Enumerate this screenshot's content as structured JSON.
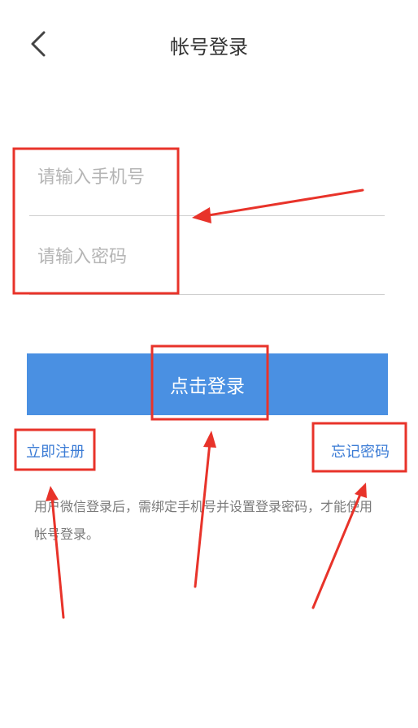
{
  "header": {
    "title": "帐号登录",
    "back_icon": "chevron-left-icon"
  },
  "form": {
    "phone_placeholder": "请输入手机号",
    "password_placeholder": "请输入密码",
    "login_label": "点击登录"
  },
  "links": {
    "register": "立即注册",
    "forgot_password": "忘记密码"
  },
  "hint": "用户微信登录后，需绑定手机号并设置登录密码，才能使用帐号登录。",
  "colors": {
    "primary": "#4a90e2",
    "link": "#3a7bd5",
    "annotation": "#e8332a"
  }
}
